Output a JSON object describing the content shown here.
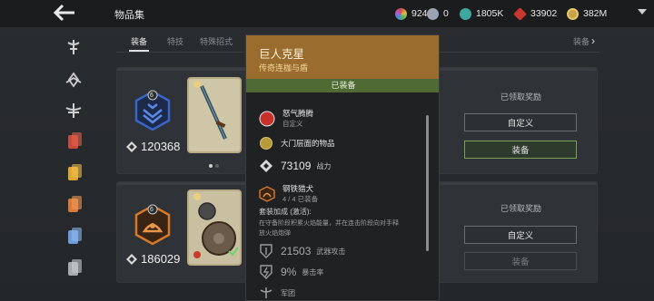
{
  "header": {
    "title": "物品集",
    "resources": [
      {
        "name": "color-wheel-resource",
        "value": "924",
        "color": "#c07bd0"
      },
      {
        "name": "skull-resource",
        "value": "0",
        "color": "#9aa4b0"
      },
      {
        "name": "gem-resource",
        "value": "1805K",
        "color": "#3fa6a0"
      },
      {
        "name": "ruby-resource",
        "value": "33902",
        "color": "#c8382e"
      },
      {
        "name": "gold-resource",
        "value": "382M",
        "color": "#c8a24a"
      }
    ]
  },
  "tabs": [
    {
      "label": "装备",
      "active": true
    },
    {
      "label": "特技",
      "active": false
    },
    {
      "label": "特殊招式",
      "active": false
    }
  ],
  "tab_right": "装备",
  "sets": [
    {
      "level": "6",
      "score": "120368",
      "medal_color": "#3a66c8",
      "status": "已领取奖励",
      "btn_custom": "自定义",
      "btn_equip": "装备",
      "equip_enabled": true
    },
    {
      "level": "6",
      "score": "186029",
      "medal_color": "#d6792a",
      "status": "已领取奖励",
      "btn_custom": "自定义",
      "btn_equip": "装备",
      "equip_enabled": false
    }
  ],
  "popup": {
    "title": "巨人克星",
    "subtitle": "传奇连枷与盾",
    "band": "已装备",
    "ability_name": "怒气腾腾",
    "ability_sub": "自定义",
    "item_name": "大门层面的物品",
    "power_value": "73109",
    "power_label": "战力",
    "set_name": "钢铁猎犬",
    "set_progress": "4 / 4 已装备",
    "set_bonus_title": "套装加成 (激活):",
    "set_bonus_desc1": "在守备阶段积累火焰能量，并在连击阶段向对手释",
    "set_bonus_desc2": "放火焰炮弹",
    "weapon_attack_value": "21503",
    "weapon_attack_label": "武器攻击",
    "crit_value": "9%",
    "crit_label": "暴击率",
    "faction_label": "军团"
  }
}
